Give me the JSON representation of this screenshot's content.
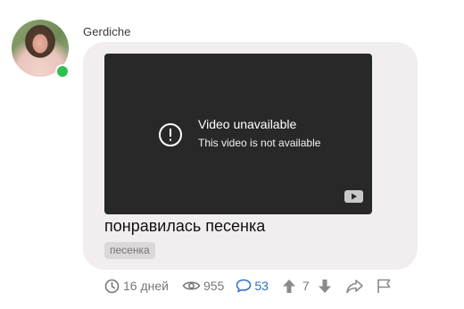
{
  "post": {
    "author": "Gerdiche",
    "online": true,
    "video": {
      "title": "Video unavailable",
      "subtitle": "This video is not available",
      "icon": "alert-circle-icon",
      "brand_icon": "youtube-icon"
    },
    "text": "понравилась песенка",
    "tags": [
      "песенка"
    ]
  },
  "stats": {
    "age": "16 дней",
    "views": "955",
    "comments": "53",
    "rating": "7"
  },
  "colors": {
    "bubble": "#f2eeef",
    "video_bg": "#282828",
    "online": "#2fbf4f",
    "link": "#2f6ec6",
    "muted": "#777777"
  }
}
